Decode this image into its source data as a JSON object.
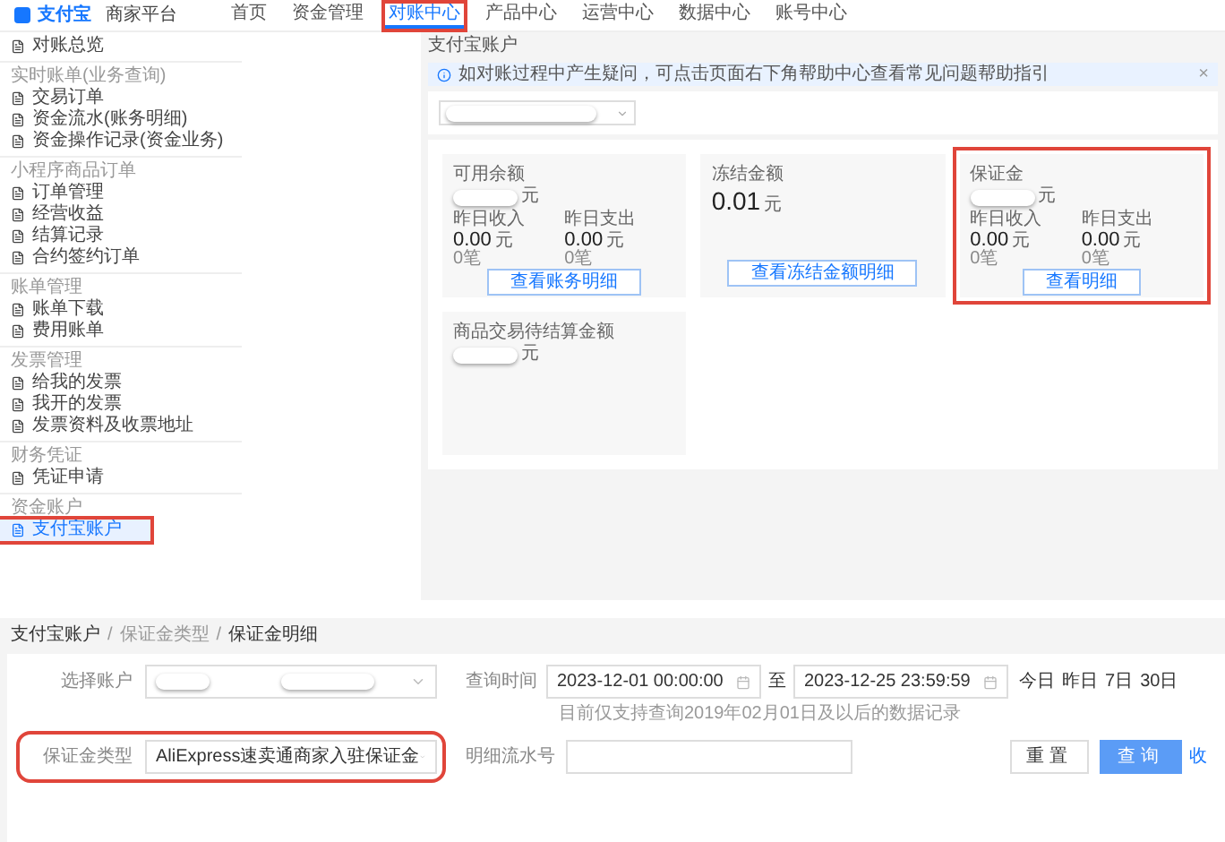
{
  "nav": {
    "logo": "支付宝",
    "platform": "商家平台",
    "tabs": [
      {
        "label": "首页",
        "selected": false,
        "highlighted": false
      },
      {
        "label": "资金管理",
        "selected": false,
        "highlighted": false
      },
      {
        "label": "对账中心",
        "selected": true,
        "highlighted": true
      },
      {
        "label": "产品中心",
        "selected": false,
        "highlighted": false
      },
      {
        "label": "运营中心",
        "selected": false,
        "highlighted": false
      },
      {
        "label": "数据中心",
        "selected": false,
        "highlighted": false
      },
      {
        "label": "账号中心",
        "selected": false,
        "highlighted": false
      }
    ]
  },
  "sidebar": {
    "top_item": {
      "label": "对账总览",
      "selected": false,
      "highlighted": false
    },
    "sections": [
      {
        "title": "实时账单(业务查询)",
        "items": [
          {
            "label": "交易订单",
            "selected": false,
            "highlighted": false
          },
          {
            "label": "资金流水(账务明细)",
            "selected": false,
            "highlighted": false
          },
          {
            "label": "资金操作记录(资金业务)",
            "selected": false,
            "highlighted": false
          }
        ]
      },
      {
        "title": "小程序商品订单",
        "items": [
          {
            "label": "订单管理",
            "selected": false,
            "highlighted": false
          },
          {
            "label": "经营收益",
            "selected": false,
            "highlighted": false
          },
          {
            "label": "结算记录",
            "selected": false,
            "highlighted": false
          },
          {
            "label": "合约签约订单",
            "selected": false,
            "highlighted": false
          }
        ]
      },
      {
        "title": "账单管理",
        "items": [
          {
            "label": "账单下载",
            "selected": false,
            "highlighted": false
          },
          {
            "label": "费用账单",
            "selected": false,
            "highlighted": false
          }
        ]
      },
      {
        "title": "发票管理",
        "items": [
          {
            "label": "给我的发票",
            "selected": false,
            "highlighted": false
          },
          {
            "label": "我开的发票",
            "selected": false,
            "highlighted": false
          },
          {
            "label": "发票资料及收票地址",
            "selected": false,
            "highlighted": false
          }
        ]
      },
      {
        "title": "财务凭证",
        "items": [
          {
            "label": "凭证申请",
            "selected": false,
            "highlighted": false
          }
        ]
      },
      {
        "title": "资金账户",
        "items": [
          {
            "label": "支付宝账户",
            "selected": true,
            "highlighted": true
          }
        ]
      }
    ]
  },
  "account_page": {
    "breadcrumb": "支付宝账户",
    "notice": "如对账过程中产生疑问，可点击页面右下角帮助中心查看常见问题帮助指引",
    "notice_close": "×",
    "cards": [
      {
        "title": "可用余额",
        "kind": "redacted",
        "unit": "元",
        "stats": [
          {
            "label": "昨日收入",
            "value": "0.00",
            "unit": "元",
            "count": "0笔"
          },
          {
            "label": "昨日支出",
            "value": "0.00",
            "unit": "元",
            "count": "0笔"
          }
        ],
        "button": "查看账务明细",
        "highlighted": false
      },
      {
        "title": "冻结金额",
        "kind": "value",
        "amount": "0.01",
        "unit": "元",
        "button": "查看冻结金额明细",
        "highlighted": false
      },
      {
        "title": "保证金",
        "kind": "redacted",
        "unit": "元",
        "stats": [
          {
            "label": "昨日收入",
            "value": "0.00",
            "unit": "元",
            "count": "0笔"
          },
          {
            "label": "昨日支出",
            "value": "0.00",
            "unit": "元",
            "count": "0笔"
          }
        ],
        "button": "查看明细",
        "highlighted": true
      },
      {
        "title": "商品交易待结算金额",
        "kind": "redacted",
        "unit": "元",
        "highlighted": false
      }
    ]
  },
  "detail_page": {
    "breadcrumb": [
      {
        "label": "支付宝账户",
        "muted": false
      },
      {
        "label": "保证金类型",
        "muted": true
      },
      {
        "label": "保证金明细",
        "muted": false
      }
    ],
    "separator": "/",
    "account_label": "选择账户",
    "time_label": "查询时间",
    "start_time": "2023-12-01 00:00:00",
    "range_word": "至",
    "end_time": "2023-12-25 23:59:59",
    "quick_ranges": [
      "今日",
      "昨日",
      "7日",
      "30日"
    ],
    "hint": "目前仅支持查询2019年02月01日及以后的数据记录",
    "type_label": "保证金类型",
    "type_value": "AliExpress速卖通商家入驻保证金",
    "type_highlighted": true,
    "serial_label": "明细流水号",
    "reset": "重置",
    "search": "查询",
    "collapse": "收"
  }
}
